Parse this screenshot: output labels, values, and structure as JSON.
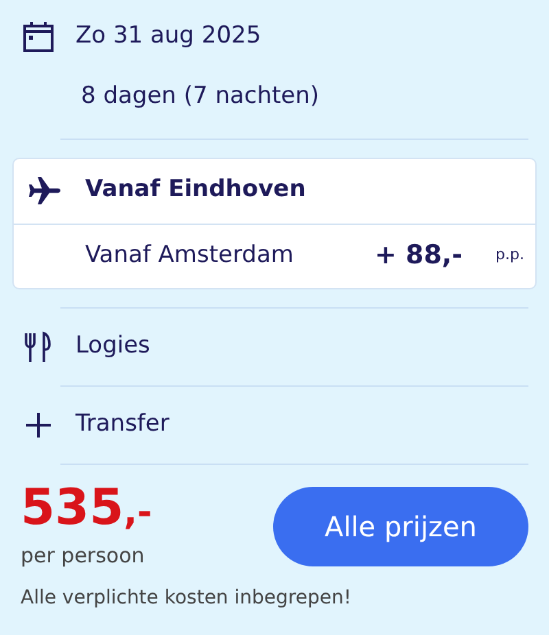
{
  "date": "Zo 31 aug 2025",
  "duration": "8 dagen (7 nachten)",
  "departures": [
    {
      "label": "Vanaf Eindhoven",
      "selected": true
    },
    {
      "label": "Vanaf Amsterdam",
      "selected": false,
      "surcharge": "+ 88,-",
      "unit": "p.p."
    }
  ],
  "features": [
    {
      "kind": "meal",
      "label": "Logies"
    },
    {
      "kind": "transfer",
      "label": "Transfer"
    }
  ],
  "price": {
    "amount": "535",
    "suffix": ",-",
    "per": "per persoon",
    "note": "Alle verplichte kosten inbegrepen!"
  },
  "button": "Alle prijzen"
}
